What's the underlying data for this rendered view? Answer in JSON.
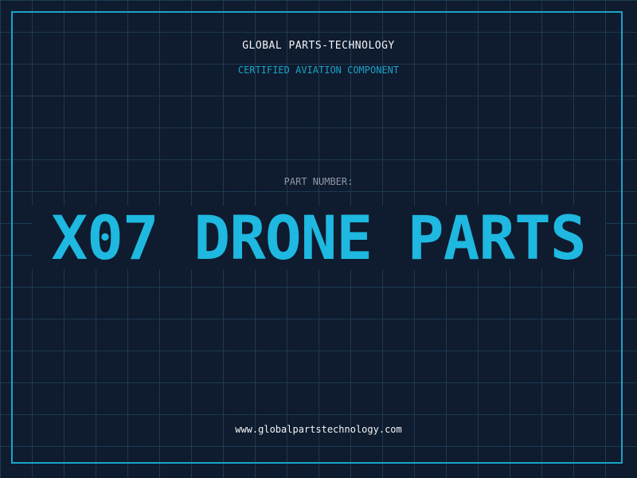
{
  "header": {
    "brand": "GLOBAL PARTS-TECHNOLOGY",
    "subtitle": "CERTIFIED AVIATION COMPONENT"
  },
  "part": {
    "label": "PART NUMBER:",
    "value": "X07 DRONE PARTS"
  },
  "footer": {
    "website": "www.globalpartstechnology.com"
  },
  "colors": {
    "background": "#0f1b2e",
    "grid": "#1c3a55",
    "accent": "#1aa3c8",
    "part_text": "#1eb8e0",
    "label_text": "#8e9aab",
    "white_text": "#f2f5f8"
  }
}
